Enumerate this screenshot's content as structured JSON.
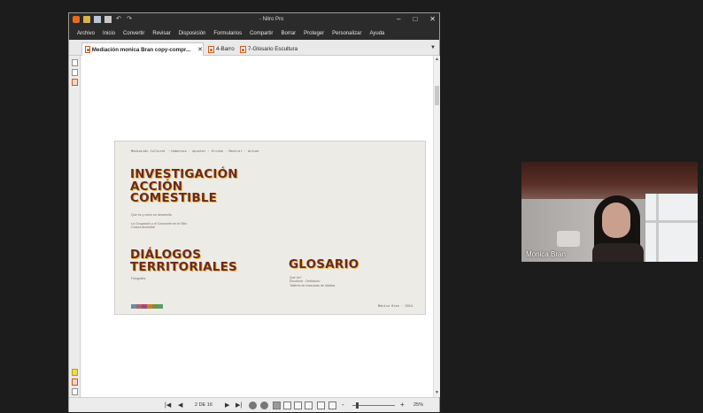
{
  "window": {
    "title": "- Nitro Pro",
    "minimize": "–",
    "maximize": "□",
    "close": "✕"
  },
  "menu": [
    "Archivo",
    "Inicio",
    "Convertir",
    "Revisar",
    "Disposición",
    "Formularios",
    "Compartir",
    "Borrar",
    "Proteger",
    "Personalizar",
    "Ayuda"
  ],
  "tabs": [
    {
      "label": "Mediación monica Bran copy-compr...",
      "active": true,
      "close": "✕"
    },
    {
      "label": "4-Barro",
      "active": false
    },
    {
      "label": "7-Glosario Escultura",
      "active": false
    }
  ],
  "tab_menu": "▼",
  "document": {
    "nav_line": "Mediación Cultural · Habernos · Apuntar · Ercibe · Mostrar · Actuar",
    "title1_lines": [
      "INVESTIGACIÓN",
      "ACCIÓN",
      "COMESTIBLE"
    ],
    "title1_sub": "Qué es y cómo se desarrolla",
    "title1_sub2": [
      "La Ocupación y el Conocerte en el Sitio",
      "Cocina Ancestral"
    ],
    "title2_lines": [
      "DIÁLOGOS",
      "TERRITORIALES"
    ],
    "title2_sub": "Fotografía",
    "title3": "GLOSARIO",
    "title3_sub": [
      "Qué es?",
      "Escultura · Definición ·",
      "Talleres de mascaras de diablos"
    ],
    "footer": "Mónica Bran · 2024",
    "swatch_colors": [
      "#5f8fb5",
      "#b16262",
      "#a24a7a",
      "#d07a30",
      "#7a8f3a",
      "#5a9a6a"
    ]
  },
  "status": {
    "first": "|◀",
    "prev": "◀",
    "page_indicator": "2 DE 16",
    "next": "▶",
    "last": "▶|",
    "zoom_minus": "-",
    "zoom_plus": "+",
    "zoom_level": "25%"
  },
  "webcam": {
    "participant_name": "Monica Bran"
  }
}
